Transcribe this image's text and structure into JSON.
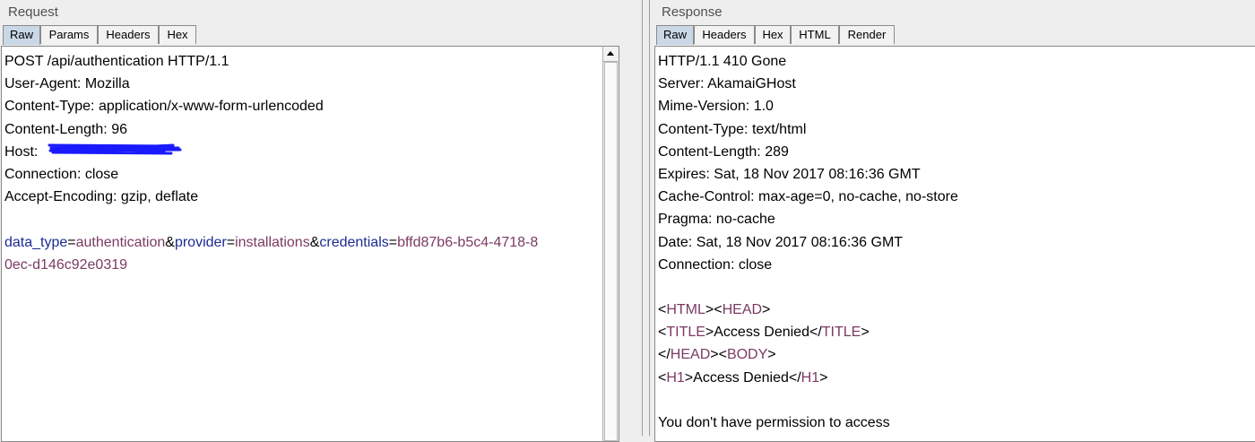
{
  "request": {
    "title": "Request",
    "tabs": [
      {
        "label": "Raw",
        "active": true
      },
      {
        "label": "Params",
        "active": false
      },
      {
        "label": "Headers",
        "active": false
      },
      {
        "label": "Hex",
        "active": false
      }
    ],
    "lines": [
      "POST /api/authentication HTTP/1.1",
      "User-Agent: Mozilla",
      "Content-Type: application/x-www-form-urlencoded",
      "Content-Length: 96",
      "Host: ",
      "Connection: close",
      "Accept-Encoding: gzip, deflate"
    ],
    "body": {
      "k1": "data_type",
      "eq1": "=",
      "v1": "authentication",
      "amp1": "&",
      "k2": "provider",
      "eq2": "=",
      "v2": "installations",
      "amp2": "&",
      "k3": "credentials",
      "eq3": "=",
      "v3a": "bffd87b6-b5c4-4718-8",
      "v3b": "0ec-d146c92e0319"
    }
  },
  "response": {
    "title": "Response",
    "tabs": [
      {
        "label": "Raw",
        "active": true
      },
      {
        "label": "Headers",
        "active": false
      },
      {
        "label": "Hex",
        "active": false
      },
      {
        "label": "HTML",
        "active": false
      },
      {
        "label": "Render",
        "active": false
      }
    ],
    "lines": [
      "HTTP/1.1 410 Gone",
      "Server: AkamaiGHost",
      "Mime-Version: 1.0",
      "Content-Type: text/html",
      "Content-Length: 289",
      "Expires: Sat, 18 Nov 2017 08:16:36 GMT",
      "Cache-Control: max-age=0, no-cache, no-store",
      "Pragma: no-cache",
      "Date: Sat, 18 Nov 2017 08:16:36 GMT",
      "Connection: close"
    ],
    "html": {
      "lt": "<",
      "gt": ">",
      "lts": "</",
      "html_tag": "HTML",
      "head_tag": "HEAD",
      "title_tag": "TITLE",
      "body_tag": "BODY",
      "h1_tag": "H1",
      "title_text": "Access Denied",
      "h1_text": "Access Denied",
      "body_text": "You don't have permission to access"
    }
  },
  "colors": {
    "key": "#1c2a92",
    "value": "#7b3a63",
    "redaction": "#1a1aff",
    "active_tab": "#c9d7e6"
  }
}
